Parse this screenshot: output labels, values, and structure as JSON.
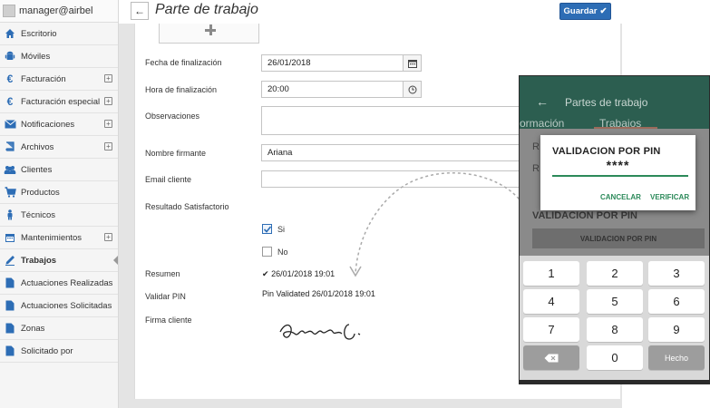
{
  "user": {
    "name": "manager@airbel"
  },
  "sidebar": {
    "items": [
      {
        "label": "Escritorio",
        "icon": "home-icon",
        "expandable": false
      },
      {
        "label": "Móviles",
        "icon": "android-icon",
        "expandable": false
      },
      {
        "label": "Facturación",
        "icon": "euro-icon",
        "expandable": true
      },
      {
        "label": "Facturación especial",
        "icon": "euro-icon",
        "expandable": true
      },
      {
        "label": "Notificaciones",
        "icon": "envelope-icon",
        "expandable": true
      },
      {
        "label": "Archivos",
        "icon": "book-icon",
        "expandable": true
      },
      {
        "label": "Clientes",
        "icon": "users-icon",
        "expandable": false
      },
      {
        "label": "Productos",
        "icon": "cart-icon",
        "expandable": false
      },
      {
        "label": "Técnicos",
        "icon": "person-icon",
        "expandable": false
      },
      {
        "label": "Mantenimientos",
        "icon": "calendar-icon",
        "expandable": true
      },
      {
        "label": "Trabajos",
        "icon": "pen-icon",
        "expandable": false,
        "active": true
      },
      {
        "label": "Actuaciones Realizadas",
        "icon": "document-icon",
        "expandable": false
      },
      {
        "label": "Actuaciones Solicitadas",
        "icon": "document-icon",
        "expandable": false
      },
      {
        "label": "Zonas",
        "icon": "document-icon",
        "expandable": false
      },
      {
        "label": "Solicitado por",
        "icon": "document-icon",
        "expandable": false
      }
    ]
  },
  "header": {
    "title": "Parte de trabajo",
    "save_label": "Guardar"
  },
  "form": {
    "fecha_label": "Fecha de finalización",
    "fecha_value": "26/01/2018",
    "hora_label": "Hora de finalización",
    "hora_value": "20:00",
    "obs_label": "Observaciones",
    "firmante_label": "Nombre firmante",
    "firmante_value": "Ariana",
    "email_label": "Email cliente",
    "resultado_label": "Resultado Satisfactorio",
    "si_label": "Si",
    "no_label": "No",
    "resumen_label": "Resumen",
    "resumen_value": "26/01/2018 19:01",
    "pin_label": "Validar PIN",
    "pin_value": "Pin Validated 26/01/2018 19:01",
    "firma_label": "Firma cliente"
  },
  "phone": {
    "title": "Partes de trabajo",
    "tab_info": "ormación",
    "tab_trabajos": "Trabajos",
    "row1": "R",
    "row2": "R",
    "validacion_label": "VALIDACION POR PIN",
    "validacion_button": "VALIDACION POR PIN",
    "dialog": {
      "title": "VALIDACION POR PIN",
      "pin": "****",
      "cancel": "CANCELAR",
      "verify": "VERIFICAR"
    },
    "keys": [
      "1",
      "2",
      "3",
      "4",
      "5",
      "6",
      "7",
      "8",
      "9",
      "",
      "0",
      "Hecho"
    ]
  },
  "colors": {
    "primary": "#2d6db5",
    "phone_header": "#2c5e50",
    "dialog_accent": "#2c8a5a"
  }
}
